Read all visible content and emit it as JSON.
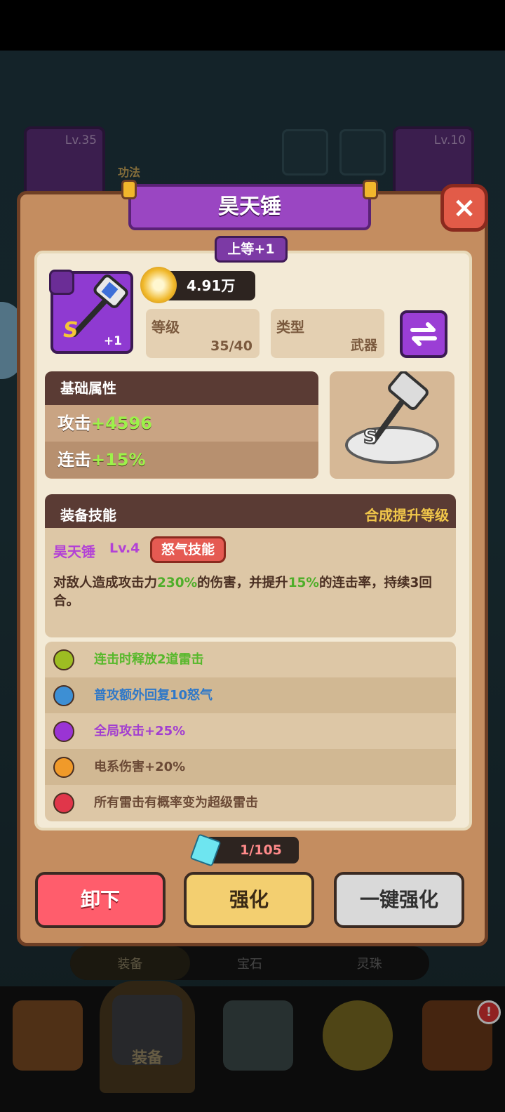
{
  "background": {
    "left_card_level": "Lv.35",
    "right_card_level": "Lv.10",
    "gongfa_label": "功法",
    "tabs": [
      "装备",
      "宝石",
      "灵珠"
    ],
    "nav_active_label": "装备",
    "nav_badge": "!"
  },
  "modal": {
    "title": "昊天锤",
    "grade": "上等+1",
    "close_symbol": "×",
    "item": {
      "plus": "+1",
      "rank": "S"
    },
    "power": "4.91万",
    "level": {
      "label": "等级",
      "value": "35/40"
    },
    "type": {
      "label": "类型",
      "value": "武器"
    },
    "base_attributes": {
      "title": "基础属性",
      "rows": [
        {
          "label": "攻击",
          "value": "+4596"
        },
        {
          "label": "连击",
          "value": "+15%"
        }
      ]
    },
    "skill": {
      "title": "装备技能",
      "upgrade_hint": "合成提升等级",
      "name": "昊天锤",
      "level": "Lv.4",
      "tag": "怒气技能",
      "desc_part1": "对敌人造成攻击力",
      "desc_pct1": "230%",
      "desc_part2": "的伤害，并提升",
      "desc_pct2": "15%",
      "desc_part3": "的连击率，持续3回合。"
    },
    "effects": [
      {
        "text": "连击时释放2道雷击",
        "color": "#57b82b",
        "dot": "#9dbd22"
      },
      {
        "text": "普攻额外回复10怒气",
        "color": "#2f78c8",
        "dot": "#3d8fd4"
      },
      {
        "text": "全局攻击+25%",
        "color": "#a23ed0",
        "dot": "#9a34d4"
      },
      {
        "text": "电系伤害+20%",
        "color": "#6b4a36",
        "dot": "#f09a2a"
      },
      {
        "text": "所有雷击有概率变为超级雷击",
        "color": "#6b4a36",
        "dot": "#e0364a"
      }
    ],
    "materials": "1/105",
    "buttons": {
      "unequip": "卸下",
      "enhance": "强化",
      "one_click": "一键强化"
    }
  }
}
